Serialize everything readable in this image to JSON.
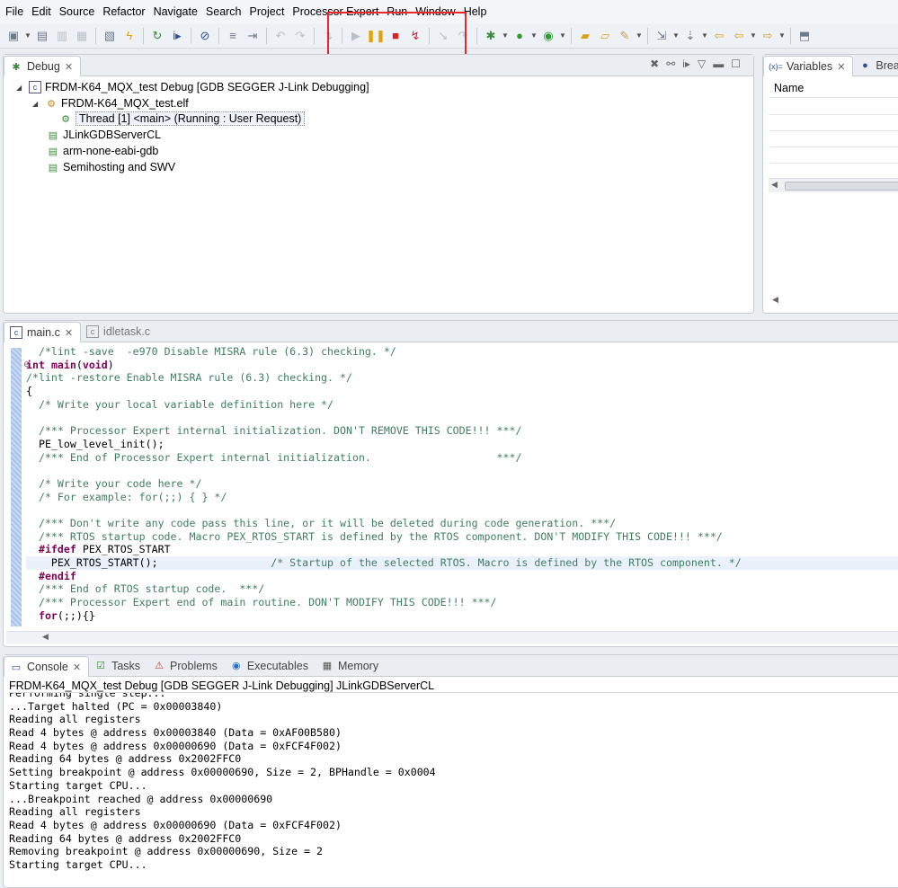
{
  "menu": [
    "File",
    "Edit",
    "Source",
    "Refactor",
    "Navigate",
    "Search",
    "Project",
    "Processor Expert",
    "Run",
    "Window",
    "Help"
  ],
  "toolbar_icons": [
    "new-icon",
    "save-icon",
    "save-all-icon",
    "print-icon",
    "binary-icon",
    "lightning-icon",
    "refresh-icon",
    "step-into-icon",
    "skip-breakpoints-icon",
    "list-icon",
    "terminate-relaunch-icon",
    "undo-icon",
    "redo-icon",
    "drop-to-frame-icon",
    "resume-icon",
    "suspend-icon",
    "terminate-icon",
    "disconnect-icon",
    "step-icon",
    "step-over-icon",
    "debug-icon",
    "run-icon",
    "external-tools-icon",
    "open-folder-icon",
    "open-file-icon",
    "pen-icon",
    "annotation-icon",
    "nav-down-icon",
    "back-icon",
    "back-arrow-icon",
    "forward-icon",
    "maximize-icon"
  ],
  "debug": {
    "tab_label": "Debug",
    "tree": {
      "launch": "FRDM-K64_MQX_test Debug [GDB SEGGER J-Link Debugging]",
      "elf": "FRDM-K64_MQX_test.elf",
      "thread": "Thread [1] <main> (Running : User Request)",
      "processes": [
        "JLinkGDBServerCL",
        "arm-none-eabi-gdb",
        "Semihosting and SWV"
      ]
    }
  },
  "variables": {
    "tab_label": "Variables",
    "tab2_label": "Breakp",
    "column_name": "Name"
  },
  "editor": {
    "tabs": [
      "main.c",
      "idletask.c"
    ],
    "lines": [
      [
        {
          "t": "  ",
          "c": "plain"
        },
        {
          "t": "/*lint -save  -e970 Disable MISRA rule (6.3) checking. */",
          "c": "comment"
        }
      ],
      [
        {
          "t": "int",
          "c": "kw"
        },
        {
          "t": " ",
          "c": "plain"
        },
        {
          "t": "main",
          "c": "kw"
        },
        {
          "t": "(",
          "c": "plain"
        },
        {
          "t": "void",
          "c": "kw"
        },
        {
          "t": ")",
          "c": "plain"
        }
      ],
      [
        {
          "t": "/*lint -restore Enable MISRA rule (6.3) checking. */",
          "c": "comment"
        }
      ],
      [
        {
          "t": "{",
          "c": "plain"
        }
      ],
      [
        {
          "t": "  /* Write your local variable definition here */",
          "c": "comment"
        }
      ],
      [
        {
          "t": "",
          "c": "plain"
        }
      ],
      [
        {
          "t": "  /*** Processor Expert internal initialization. DON'T REMOVE THIS CODE!!! ***/",
          "c": "comment"
        }
      ],
      [
        {
          "t": "  PE_low_level_init();",
          "c": "plain"
        }
      ],
      [
        {
          "t": "  /*** End of Processor Expert internal initialization.                    ***/",
          "c": "comment"
        }
      ],
      [
        {
          "t": "",
          "c": "plain"
        }
      ],
      [
        {
          "t": "  /* Write your code here */",
          "c": "comment"
        }
      ],
      [
        {
          "t": "  /* For example: for(;;) { } */",
          "c": "comment"
        }
      ],
      [
        {
          "t": "",
          "c": "plain"
        }
      ],
      [
        {
          "t": "  /*** Don't write any code pass this line, or it will be deleted during code generation. ***/",
          "c": "comment"
        }
      ],
      [
        {
          "t": "  /*** RTOS startup code. Macro PEX_RTOS_START is defined by the RTOS component. DON'T MODIFY THIS CODE!!! ***/",
          "c": "comment"
        }
      ],
      [
        {
          "t": "  ",
          "c": "plain"
        },
        {
          "t": "#ifdef",
          "c": "kw"
        },
        {
          "t": " PEX_RTOS_START",
          "c": "plain"
        }
      ],
      [
        {
          "t": "    PEX_RTOS_START();                  ",
          "c": "plain"
        },
        {
          "t": "/* Startup of the selected RTOS. Macro is defined by the RTOS component. */",
          "c": "comment"
        }
      ],
      [
        {
          "t": "  ",
          "c": "plain"
        },
        {
          "t": "#endif",
          "c": "kw"
        }
      ],
      [
        {
          "t": "  /*** End of RTOS startup code.  ***/",
          "c": "comment"
        }
      ],
      [
        {
          "t": "  /*** Processor Expert end of main routine. DON'T MODIFY THIS CODE!!! ***/",
          "c": "comment"
        }
      ],
      [
        {
          "t": "  ",
          "c": "plain"
        },
        {
          "t": "for",
          "c": "kw"
        },
        {
          "t": "(;;){}",
          "c": "plain"
        }
      ]
    ]
  },
  "console": {
    "tabs": [
      "Console",
      "Tasks",
      "Problems",
      "Executables",
      "Memory"
    ],
    "title": "FRDM-K64_MQX_test Debug [GDB SEGGER J-Link Debugging] JLinkGDBServerCL",
    "lines": [
      "Performing single step...",
      "...Target halted (PC = 0x00003840)",
      "Reading all registers",
      "Read 4 bytes @ address 0x00003840 (Data = 0xAF00B580)",
      "Read 4 bytes @ address 0x00000690 (Data = 0xFCF4F002)",
      "Reading 64 bytes @ address 0x2002FFC0",
      "Setting breakpoint @ address 0x00000690, Size = 2, BPHandle = 0x0004",
      "Starting target CPU...",
      "...Breakpoint reached @ address 0x00000690",
      "Reading all registers",
      "Read 4 bytes @ address 0x00000690 (Data = 0xFCF4F002)",
      "Reading 64 bytes @ address 0x2002FFC0",
      "Removing breakpoint @ address 0x00000690, Size = 2",
      "Starting target CPU..."
    ]
  },
  "colors": {
    "highlight": "#e8262b",
    "comment": "#3f7f5f",
    "keyword": "#7f0055"
  }
}
